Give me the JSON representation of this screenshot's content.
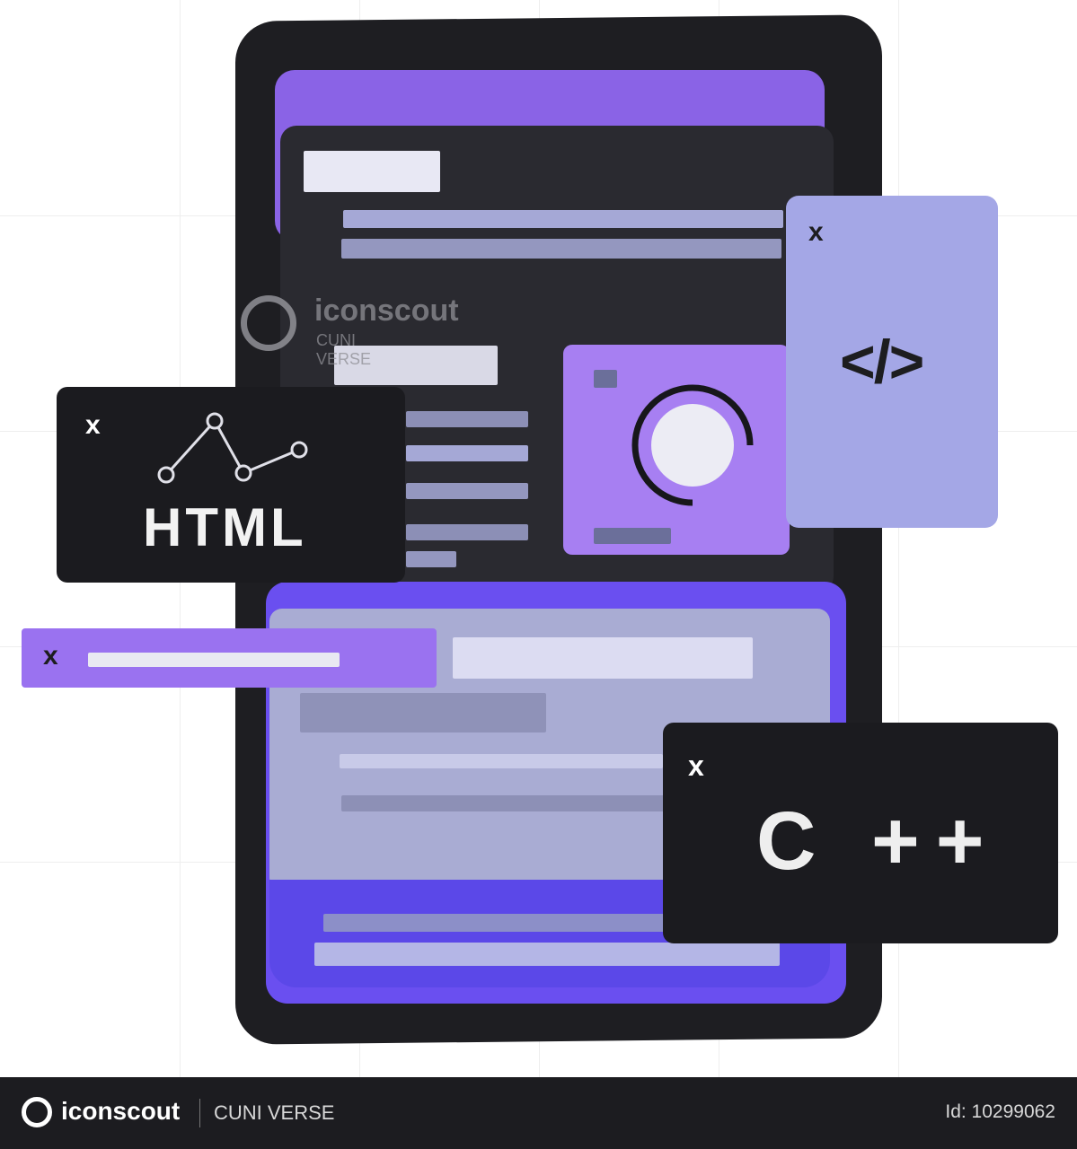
{
  "html_card": {
    "close": "x",
    "label": "HTML"
  },
  "code_card": {
    "close": "x",
    "icon_text": "</>"
  },
  "tab_bar": {
    "close": "x"
  },
  "cpp_card": {
    "close": "x",
    "label": "C ++"
  },
  "watermark": {
    "brand": "iconscout",
    "author": "CUNI VERSE"
  },
  "footer": {
    "brand": "iconscout",
    "author": "CUNI VERSE",
    "id_label": "Id: 10299062"
  },
  "colors": {
    "dark": "#1b1b1f",
    "purple": "#a77ff2",
    "lavender": "#a4a7e6",
    "blue": "#6a4ff0"
  },
  "icons": [
    "close-icon",
    "code-icon",
    "line-chart-icon",
    "camera-icon",
    "iconscout-logo-icon"
  ]
}
